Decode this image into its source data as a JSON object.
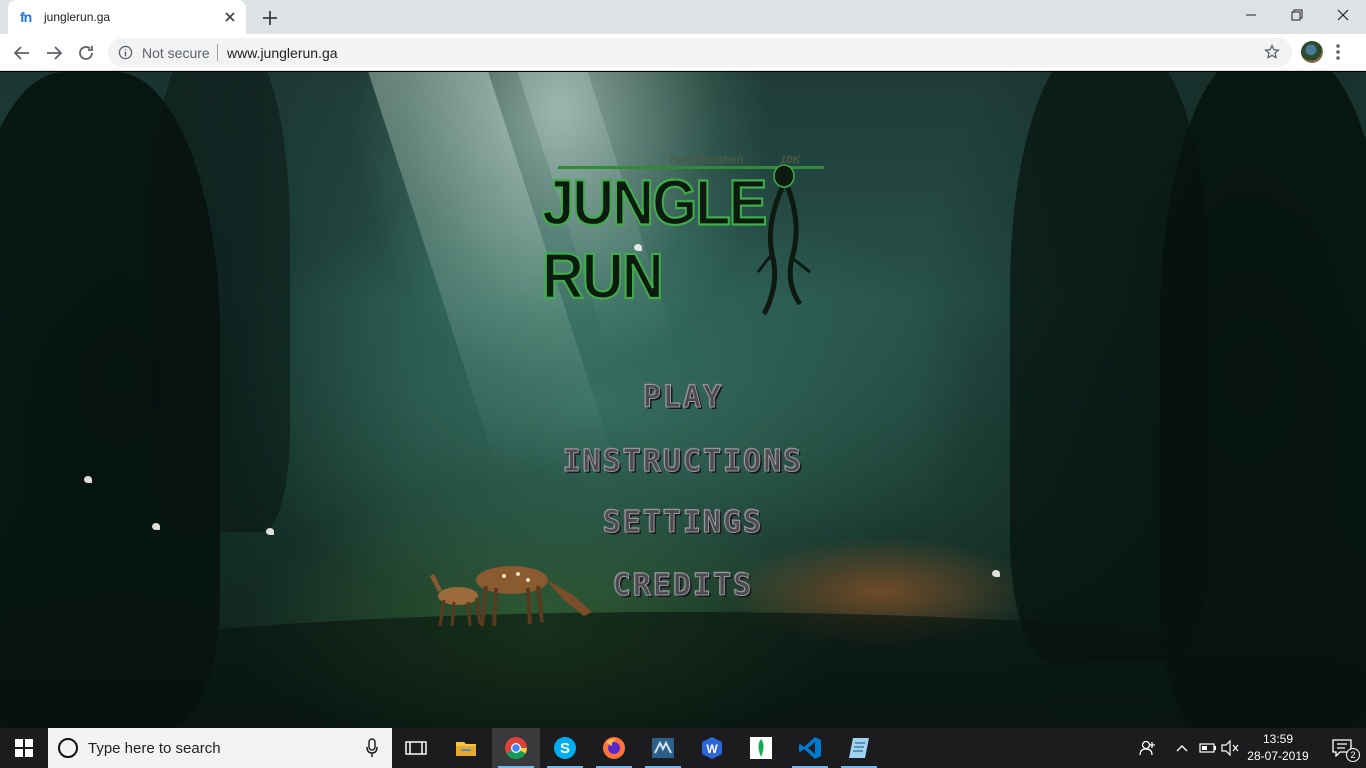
{
  "browser": {
    "tab": {
      "favicon": "fn",
      "title": "junglerun.ga",
      "close_icon": "close-icon"
    },
    "new_tab_icon": "plus-icon",
    "window_controls": [
      "minimize-icon",
      "restore-icon",
      "close-icon"
    ],
    "toolbar": {
      "back_icon": "arrow-left-icon",
      "forward_icon": "arrow-right-icon",
      "reload_icon": "reload-icon",
      "security_label": "Not secure",
      "url": "www.junglerun.ga",
      "bookmark_icon": "star-icon",
      "menu_icon": "kebab-icon"
    }
  },
  "game": {
    "logo": {
      "tagline_left": "Half Marathon",
      "tagline_right": "10K",
      "wordmark": "JUNGLE RUN"
    },
    "menu": {
      "play": "PLAY",
      "instructions": "INSTRUCTIONS",
      "settings": "SETTINGS",
      "credits": "CREDITS"
    }
  },
  "taskbar": {
    "search_placeholder": "Type here to search",
    "apps": [
      "task-view-icon",
      "file-explorer-icon",
      "chrome-icon",
      "skype-icon",
      "firefox-icon",
      "vm-icon",
      "wps-writer-icon",
      "mongodb-compass-icon",
      "vscode-icon",
      "notepad-icon"
    ],
    "clock": {
      "time": "13:59",
      "date": "28-07-2019"
    },
    "notification_count": "2",
    "colors": {
      "accent": "#76b9ed"
    }
  }
}
